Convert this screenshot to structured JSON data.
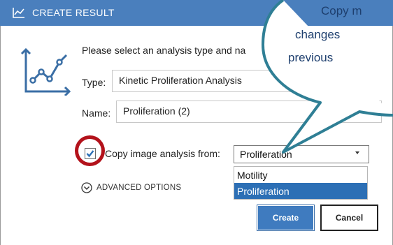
{
  "window": {
    "title": "CREATE RESULT",
    "title_icon": "line-chart-icon"
  },
  "dialog": {
    "prompt": "Please select an analysis type and na",
    "side_icon": "line-chart-icon",
    "type_label": "Type:",
    "type_value": "Kinetic Proliferation Analysis",
    "name_label": "Name:",
    "name_value": "Proliferation (2)",
    "copy_checkbox_checked": true,
    "copy_label": "Copy image analysis from:",
    "copy_source_selected": "Proliferation",
    "copy_source_options": [
      {
        "label": "Motility",
        "selected": false
      },
      {
        "label": "Proliferation",
        "selected": true
      }
    ],
    "advanced_options_label": "ADVANCED OPTIONS",
    "advanced_icon": "chevron-down-circle-icon",
    "create_label": "Create",
    "cancel_label": "Cancel"
  },
  "callout": {
    "lines": [
      "Copy m",
      "changes",
      "previous"
    ]
  },
  "colors": {
    "titlebar": "#4a7fbd",
    "accent": "#3f7bbf",
    "selection": "#2c6fb5",
    "highlight_ring": "#b3121b",
    "callout_border": "#2f7f95",
    "callout_text": "#1e3f6e"
  }
}
